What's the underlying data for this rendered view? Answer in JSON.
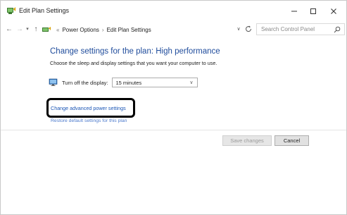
{
  "window": {
    "title": "Edit Plan Settings",
    "minimize_glyph": "—",
    "maximize_glyph": "☐",
    "close_glyph": "✕"
  },
  "nav": {
    "back_glyph": "←",
    "forward_glyph": "→",
    "recent_glyph": "▾",
    "up_glyph": "↑"
  },
  "address": {
    "overflow": "«",
    "crumbs": [
      "Power Options",
      "Edit Plan Settings"
    ],
    "separator": "›",
    "dropdown_glyph": "∨"
  },
  "search": {
    "placeholder": "Search Control Panel"
  },
  "main": {
    "heading": "Change settings for the plan: High performance",
    "subtext": "Choose the sleep and display settings that you want your computer to use.",
    "display_label": "Turn off the display:",
    "display_value": "15 minutes",
    "select_glyph": "∨",
    "advanced_link": "Change advanced power settings",
    "restore_link": "Restore default settings for this plan"
  },
  "footer": {
    "save_label": "Save changes",
    "cancel_label": "Cancel"
  },
  "colors": {
    "heading": "#1e4b9b",
    "link": "#1a55b5",
    "highlight_border": "#000000"
  }
}
